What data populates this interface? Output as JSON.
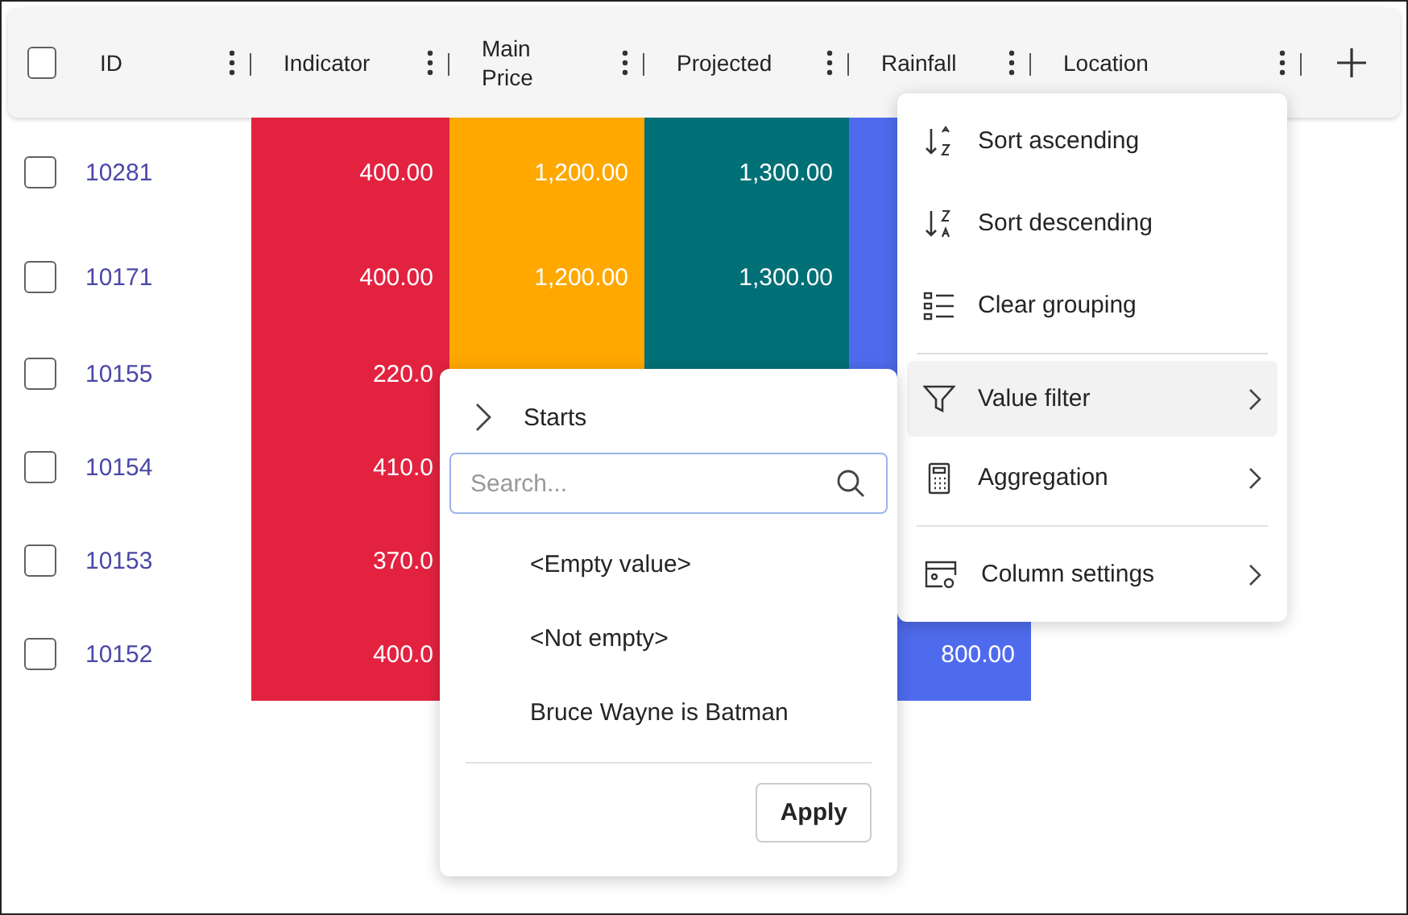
{
  "grid": {
    "header_checkbox": {
      "checked": false
    },
    "columns": [
      {
        "label": "ID"
      },
      {
        "label": "Indicator",
        "color": "#e32240"
      },
      {
        "label": "Main\nPrice",
        "color": "#ffa800"
      },
      {
        "label": "Projected",
        "color": "#007076"
      },
      {
        "label": "Rainfall",
        "color": "#4f6bed"
      },
      {
        "label": "Location"
      }
    ],
    "rows": [
      {
        "checked": false,
        "id": "10281",
        "cells": [
          "400.00",
          "1,200.00",
          "1,300.00",
          ""
        ]
      },
      {
        "checked": false,
        "id": "10171",
        "cells": [
          "400.00",
          "1,200.00",
          "1,300.00",
          ""
        ]
      },
      {
        "checked": false,
        "id": "10155",
        "cells": [
          "220.0",
          "",
          "",
          ""
        ]
      },
      {
        "checked": false,
        "id": "10154",
        "cells": [
          "410.0",
          null,
          null,
          null
        ]
      },
      {
        "checked": false,
        "id": "10153",
        "cells": [
          "370.0",
          null,
          null,
          null
        ]
      },
      {
        "checked": false,
        "id": "10152",
        "cells": [
          "400.0",
          null,
          null,
          "800.00"
        ]
      }
    ]
  },
  "column_menu": {
    "items": [
      {
        "label": "Sort ascending",
        "submenu": false,
        "separator_before": false,
        "selected": false
      },
      {
        "label": "Sort descending",
        "submenu": false,
        "separator_before": false,
        "selected": false
      },
      {
        "label": "Clear grouping",
        "submenu": false,
        "separator_before": false,
        "selected": false
      },
      {
        "label": "Value filter",
        "submenu": true,
        "separator_before": true,
        "selected": true
      },
      {
        "label": "Aggregation",
        "submenu": true,
        "separator_before": false,
        "selected": false
      },
      {
        "label": "Column settings",
        "submenu": true,
        "separator_before": true,
        "selected": false
      }
    ]
  },
  "filter_popup": {
    "condition": {
      "label": "Starts",
      "expanded": false
    },
    "search": {
      "placeholder": "Search..."
    },
    "options": [
      "<Empty value>",
      "<Not empty>",
      "Bruce Wayne is Batman"
    ],
    "apply": "Apply"
  }
}
